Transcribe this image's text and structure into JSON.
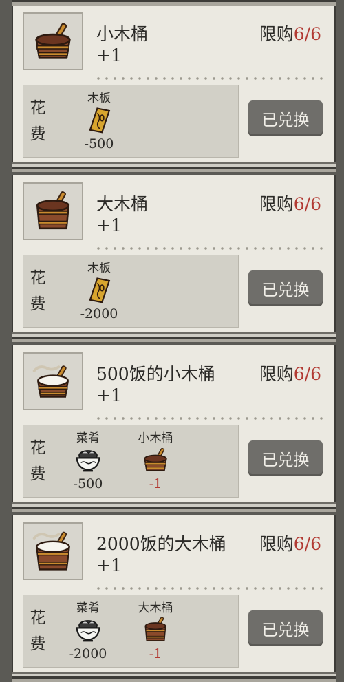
{
  "cost_label": [
    "花",
    "费"
  ],
  "items": [
    {
      "title": "小木桶",
      "gain": "+1",
      "limit_label": "限购",
      "limit_value": "6/6",
      "icon": "small-bucket-icon",
      "costs": [
        {
          "name": "木板",
          "amount": "-500",
          "icon": "wood-plank-icon",
          "red": false
        }
      ],
      "button": "已兑换"
    },
    {
      "title": "大木桶",
      "gain": "+1",
      "limit_label": "限购",
      "limit_value": "6/6",
      "icon": "large-bucket-icon",
      "costs": [
        {
          "name": "木板",
          "amount": "-2000",
          "icon": "wood-plank-icon",
          "red": false
        }
      ],
      "button": "已兑换"
    },
    {
      "title": "500饭的小木桶",
      "gain": "+1",
      "limit_label": "限购",
      "limit_value": "6/6",
      "icon": "rice-small-bucket-icon",
      "costs": [
        {
          "name": "菜肴",
          "amount": "-500",
          "icon": "dish-bowl-icon",
          "red": false
        },
        {
          "name": "小木桶",
          "amount": "-1",
          "icon": "small-bucket-icon",
          "red": true
        }
      ],
      "button": "已兑换"
    },
    {
      "title": "2000饭的大木桶",
      "gain": "+1",
      "limit_label": "限购",
      "limit_value": "6/6",
      "icon": "rice-large-bucket-icon",
      "costs": [
        {
          "name": "菜肴",
          "amount": "-2000",
          "icon": "dish-bowl-icon",
          "red": false
        },
        {
          "name": "大木桶",
          "amount": "-1",
          "icon": "large-bucket-icon",
          "red": true
        }
      ],
      "button": "已兑换"
    }
  ],
  "colors": {
    "limit_value": "#b23a33",
    "button_bg": "#6f6e6a",
    "card_bg": "#ebe9e1"
  }
}
